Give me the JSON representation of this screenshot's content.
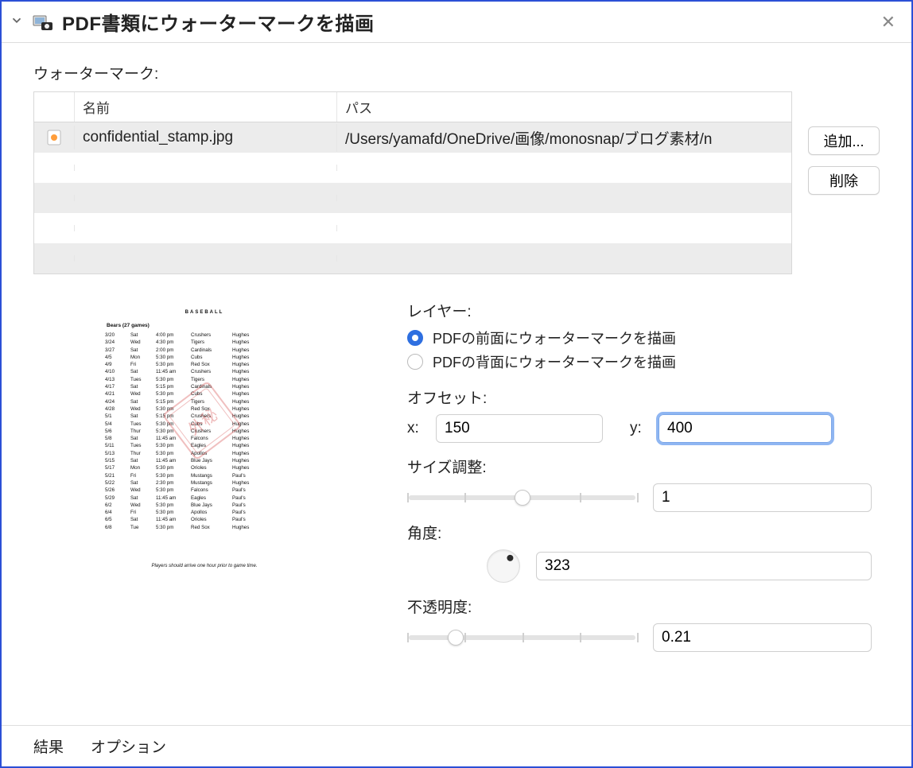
{
  "header": {
    "title": "PDF書類にウォーターマークを描画"
  },
  "watermark": {
    "section_label": "ウォーターマーク:",
    "columns": {
      "name": "名前",
      "path": "パス"
    },
    "rows": [
      {
        "name": "confidential_stamp.jpg",
        "path": "/Users/yamafd/OneDrive/画像/monosnap/ブログ素材/n"
      }
    ],
    "add_button": "追加...",
    "delete_button": "削除"
  },
  "layer": {
    "label": "レイヤー:",
    "option_front": "PDFの前面にウォーターマークを描画",
    "option_back": "PDFの背面にウォーターマークを描画",
    "selected": "front"
  },
  "offset": {
    "label": "オフセット:",
    "x_label": "x:",
    "y_label": "y:",
    "x": "150",
    "y": "400"
  },
  "scale": {
    "label": "サイズ調整:",
    "value": "1",
    "slider_pos": 0.5
  },
  "angle": {
    "label": "角度:",
    "value": "323"
  },
  "opacity": {
    "label": "不透明度:",
    "value": "0.21",
    "slider_pos": 0.21
  },
  "footer": {
    "results": "結果",
    "options": "オプション"
  },
  "preview": {
    "title": "Baseball",
    "subtitle": "Bears (27 games)",
    "footer": "Players should arrive one hour prior to game time.",
    "stamp_text": "外秘",
    "schedule": [
      [
        "3/20",
        "Sat",
        "4:00 pm",
        "Crushers",
        "Hughes"
      ],
      [
        "3/24",
        "Wed",
        "4:30 pm",
        "Tigers",
        "Hughes"
      ],
      [
        "3/27",
        "Sat",
        "2:00 pm",
        "Cardinals",
        "Hughes"
      ],
      [
        "4/5",
        "Mon",
        "5:30 pm",
        "Cubs",
        "Hughes"
      ],
      [
        "4/9",
        "Fri",
        "5:30 pm",
        "Red Sox",
        "Hughes"
      ],
      [
        "4/10",
        "Sat",
        "11:45 am",
        "Crushers",
        "Hughes"
      ],
      [
        "4/13",
        "Tues",
        "5:30 pm",
        "Tigers",
        "Hughes"
      ],
      [
        "4/17",
        "Sat",
        "5:15 pm",
        "Cardinals",
        "Hughes"
      ],
      [
        "4/21",
        "Wed",
        "5:30 pm",
        "Cubs",
        "Hughes"
      ],
      [
        "4/24",
        "Sat",
        "5:15 pm",
        "Tigers",
        "Hughes"
      ],
      [
        "4/28",
        "Wed",
        "5:30 pm",
        "Red Sox",
        "Hughes"
      ],
      [
        "5/1",
        "Sat",
        "5:15 pm",
        "Crushers",
        "Hughes"
      ],
      [
        "5/4",
        "Tues",
        "5:30 pm",
        "Cubs",
        "Hughes"
      ],
      [
        "5/6",
        "Thur",
        "5:30 pm",
        "Crushers",
        "Hughes"
      ],
      [
        "5/8",
        "Sat",
        "11:45 am",
        "Falcons",
        "Hughes"
      ],
      [
        "5/11",
        "Tues",
        "5:30 pm",
        "Eagles",
        "Hughes"
      ],
      [
        "5/13",
        "Thur",
        "5:30 pm",
        "Apollos",
        "Hughes"
      ],
      [
        "5/15",
        "Sat",
        "11:45 am",
        "Blue Jays",
        "Hughes"
      ],
      [
        "5/17",
        "Mon",
        "5:30 pm",
        "Orioles",
        "Hughes"
      ],
      [
        "5/21",
        "Fri",
        "5:30 pm",
        "Mustangs",
        "Paul's"
      ],
      [
        "5/22",
        "Sat",
        "2:30 pm",
        "Mustangs",
        "Hughes"
      ],
      [
        "5/26",
        "Wed",
        "5:30 pm",
        "Falcons",
        "Paul's"
      ],
      [
        "5/29",
        "Sat",
        "11:45 am",
        "Eagles",
        "Paul's"
      ],
      [
        "6/2",
        "Wed",
        "5:30 pm",
        "Blue Jays",
        "Paul's"
      ],
      [
        "6/4",
        "Fri",
        "5:30 pm",
        "Apollos",
        "Paul's"
      ],
      [
        "6/5",
        "Sat",
        "11:45 am",
        "Orioles",
        "Paul's"
      ],
      [
        "6/8",
        "Tue",
        "5:30 pm",
        "Red Sox",
        "Hughes"
      ]
    ]
  }
}
